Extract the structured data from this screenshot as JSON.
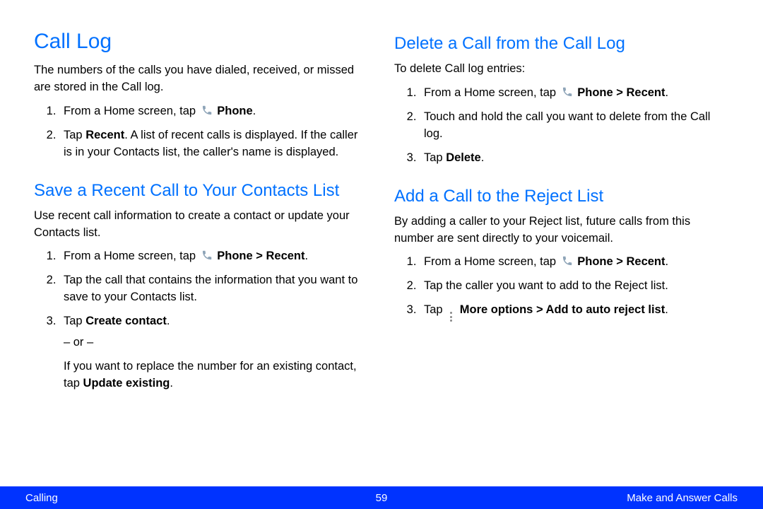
{
  "left": {
    "h1": "Call Log",
    "intro": "The numbers of the calls you have dialed, received, or missed are stored in the Call log.",
    "callLogSteps": {
      "s1a": "From a Home screen, tap ",
      "s1b": "Phone",
      "s1c": ".",
      "s2a": "Tap ",
      "s2b": "Recent",
      "s2c": ". A list of recent calls is displayed. If the caller is in your Contacts list, the caller's name is displayed."
    },
    "h2": "Save a Recent Call to Your Contacts List",
    "saveIntro": "Use recent call information to create a contact or update your Contacts list.",
    "saveSteps": {
      "s1a": "From a Home screen, tap ",
      "s1b": "Phone > Recent",
      "s1c": ".",
      "s2": "Tap the call that contains the information that you want to save to your Contacts list.",
      "s3a": "Tap ",
      "s3b": "Create contact",
      "s3c": ".",
      "or": "– or –",
      "s3d": "If you want to replace the number for an existing contact, tap ",
      "s3e": "Update existing",
      "s3f": "."
    }
  },
  "right": {
    "h2a": "Delete a Call from the Call Log",
    "delIntro": "To delete Call log entries:",
    "delSteps": {
      "s1a": "From a Home screen, tap ",
      "s1b": "Phone > Recent",
      "s1c": ".",
      "s2": "Touch and hold the call you want to delete from the Call log.",
      "s3a": "Tap ",
      "s3b": "Delete",
      "s3c": "."
    },
    "h2b": "Add a Call to the Reject List",
    "rejIntro": "By adding a caller to your Reject list, future calls from this number are sent directly to your voicemail.",
    "rejSteps": {
      "s1a": "From a Home screen, tap ",
      "s1b": "Phone > Recent",
      "s1c": ".",
      "s2": "Tap the caller you want to add to the Reject list.",
      "s3a": "Tap ",
      "s3b": "More options > Add to auto reject list",
      "s3c": "."
    }
  },
  "footer": {
    "left": "Calling",
    "page": "59",
    "right": "Make and Answer Calls"
  }
}
